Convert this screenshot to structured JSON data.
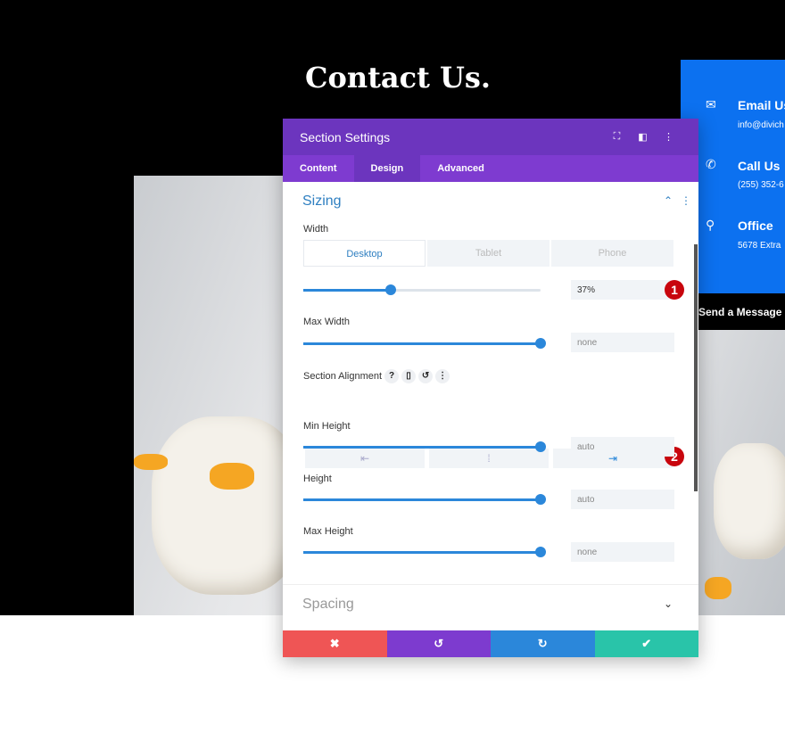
{
  "page": {
    "title": "Contact Us."
  },
  "contact": {
    "items": [
      {
        "icon": "envelope-icon",
        "glyph": "✉",
        "title": "Email Us",
        "sub": "info@divich"
      },
      {
        "icon": "phone-icon",
        "glyph": "✆",
        "title": "Call Us",
        "sub": "(255) 352-6"
      },
      {
        "icon": "map-pin-icon",
        "glyph": "⚲",
        "title": "Office",
        "sub": "5678 Extra"
      }
    ],
    "send": "Send a Message",
    "color": "#0c71f0"
  },
  "modal": {
    "title": "Section Settings",
    "tabs": [
      "Content",
      "Design",
      "Advanced"
    ],
    "active_tab": "Design",
    "section": "Sizing",
    "collapsed_section": "Spacing",
    "width": {
      "label": "Width",
      "devices": [
        "Desktop",
        "Tablet",
        "Phone"
      ],
      "value": "37%",
      "slider": 37
    },
    "max_width": {
      "label": "Max Width",
      "value": "none",
      "slider": 100
    },
    "alignment": {
      "label": "Section Alignment",
      "options": [
        "⇤",
        "⁞",
        "⇥"
      ],
      "selected": "right"
    },
    "min_height": {
      "label": "Min Height",
      "value": "auto",
      "slider": 100
    },
    "height": {
      "label": "Height",
      "value": "auto",
      "slider": 100
    },
    "max_height": {
      "label": "Max Height",
      "value": "none",
      "slider": 100
    },
    "badges": [
      "1",
      "2"
    ],
    "footer": {
      "cancel": "✖",
      "undo": "↺",
      "redo": "↻",
      "save": "✔"
    },
    "colors": {
      "header": "#6c35be",
      "tabs": "#7e3bd0",
      "cancel": "#ef5555",
      "undo": "#7d3bcf",
      "redo": "#2b87da",
      "save": "#29c4a9"
    }
  }
}
